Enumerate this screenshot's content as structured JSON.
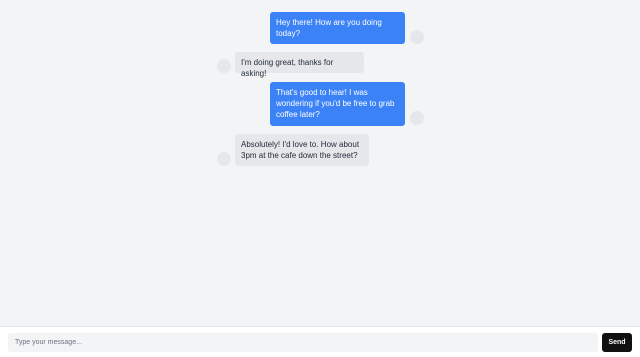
{
  "messages": [
    {
      "from": "me",
      "text": "Hey there! How are you doing today?"
    },
    {
      "from": "them",
      "text": "I'm doing great, thanks for asking!"
    },
    {
      "from": "me",
      "text": "That's good to hear! I was wondering if you'd be free to grab coffee later?"
    },
    {
      "from": "them",
      "text": "Absolutely! I'd love to. How about 3pm at the cafe down the street?"
    }
  ],
  "composer": {
    "placeholder": "Type your message...",
    "send_label": "Send"
  },
  "colors": {
    "sent_bubble": "#3b82f6",
    "received_bubble": "#e5e7eb",
    "background": "#f3f4f6",
    "send_button": "#111111"
  }
}
